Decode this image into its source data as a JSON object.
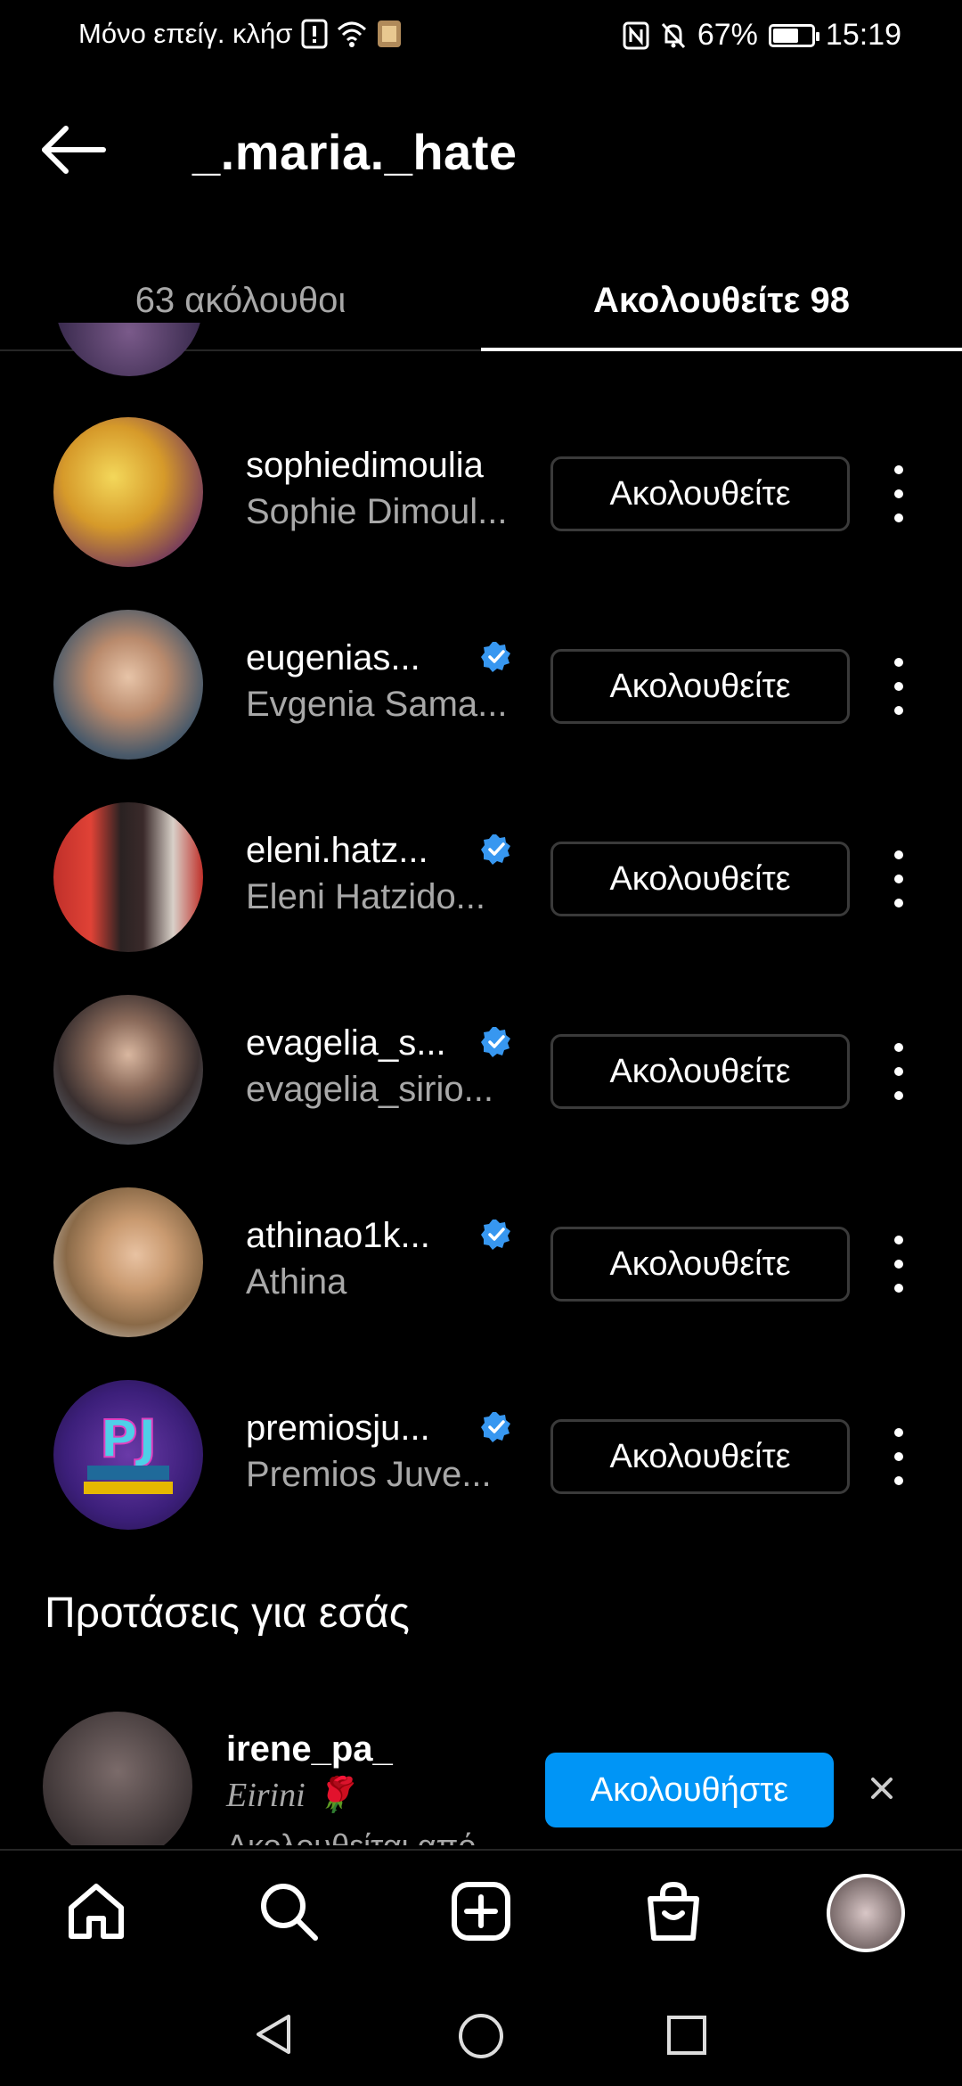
{
  "status": {
    "carrier": "Μόνο επείγ. κλήσ",
    "battery_percent": "67%",
    "battery_level": 0.67,
    "time": "15:19"
  },
  "header": {
    "title": "_.maria._hate"
  },
  "tabs": [
    {
      "label": "63 ακόλουθοι",
      "active": false
    },
    {
      "label": "Ακολουθείτε 98",
      "active": true
    }
  ],
  "following": [
    {
      "username": "sophiedimoulia",
      "full_name": "Sophie Dimoul...",
      "verified": false,
      "button": "Ακολουθείτε"
    },
    {
      "username": "eugenias...",
      "full_name": "Evgenia Sama...",
      "verified": true,
      "button": "Ακολουθείτε"
    },
    {
      "username": "eleni.hatz...",
      "full_name": "Eleni Hatzido...",
      "verified": true,
      "button": "Ακολουθείτε"
    },
    {
      "username": "evagelia_s...",
      "full_name": "evagelia_sirio...",
      "verified": true,
      "button": "Ακολουθείτε"
    },
    {
      "username": "athinao1k...",
      "full_name": "Athina",
      "verified": true,
      "button": "Ακολουθείτε"
    },
    {
      "username": "premiosju...",
      "full_name": "Premios Juve...",
      "verified": true,
      "button": "Ακολουθείτε"
    }
  ],
  "suggestions": {
    "title": "Προτάσεις για εσάς",
    "items": [
      {
        "username": "irene_pa_",
        "full_name": "Eirini 🌹",
        "subtitle": "Ακολουθείται από",
        "button": "Ακολουθήστε"
      }
    ]
  },
  "colors": {
    "background": "#000000",
    "accent_blue": "#0095f6",
    "secondary_text": "#a8a8a8",
    "button_border": "#3a3a3a"
  }
}
